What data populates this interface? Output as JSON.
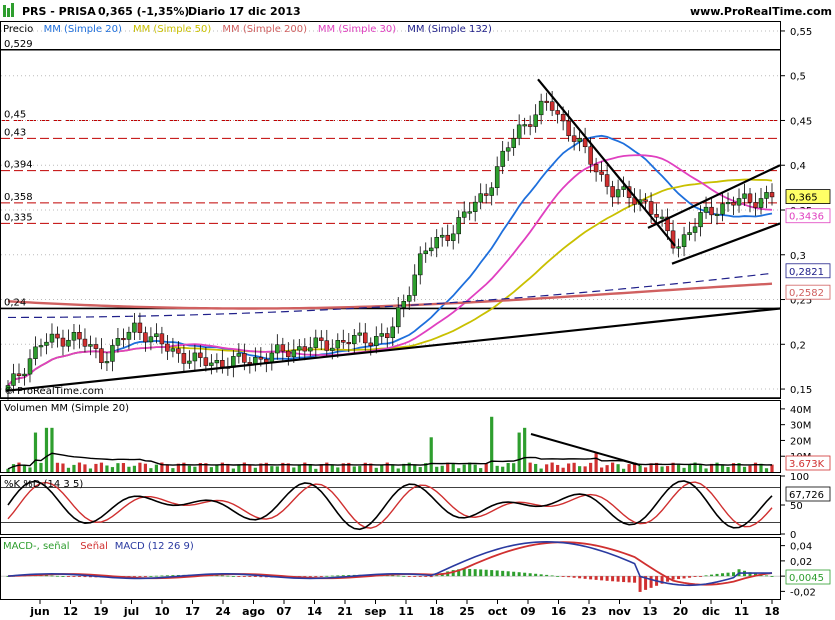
{
  "header": {
    "ticker": "PRS - PRISA",
    "last_change": "0,365 (-1,35%)",
    "period_date": "Diario  17 dic 2013",
    "site": "www.ProRealTime.com"
  },
  "price_panel": {
    "legend": [
      {
        "text": "Precio",
        "color": "#000000"
      },
      {
        "text": "MM (Simple 20)",
        "color": "#1e6fdc"
      },
      {
        "text": "MM (Simple 50)",
        "color": "#c9c000"
      },
      {
        "text": "MM (Simple 200)",
        "color": "#d06060"
      },
      {
        "text": "MM (Simple 30)",
        "color": "#e040c0"
      },
      {
        "text": "MM (Simple 132)",
        "color": "#20208a"
      }
    ],
    "copyright": "© ProRealTime.com",
    "level_labels": [
      "0,529",
      "0,45",
      "0,43",
      "0,394",
      "0,358",
      "0,335",
      "0,24"
    ],
    "axis_ticks": [
      "0,55",
      "0,5",
      "0,45",
      "0,4",
      "0,35",
      "0,3",
      "0,25",
      "0,2",
      "0,15"
    ],
    "badges": [
      {
        "text": "0,365",
        "color": "#000000",
        "bg": "#ffff66"
      },
      {
        "text": "0,3436",
        "color": "#e040c0",
        "bg": "#ffffff"
      },
      {
        "text": "0,2821",
        "color": "#20208a",
        "bg": "#ffffff"
      },
      {
        "text": "0,2582",
        "color": "#d06060",
        "bg": "#ffffff"
      }
    ]
  },
  "volume_panel": {
    "legend": "Volumen MM (Simple 20)",
    "axis_ticks": [
      "40M",
      "30M",
      "20M",
      "10M"
    ],
    "badge": "3.673K"
  },
  "stoch_panel": {
    "legend": "%K %D (14 3 5)",
    "axis_ticks": [
      "100",
      "50",
      "0"
    ],
    "badge": "67,726"
  },
  "macd_panel": {
    "legend_parts": [
      {
        "text": "MACD-, señal",
        "color": "#2e9e2e"
      },
      {
        "text": "Señal",
        "color": "#d03030"
      },
      {
        "text": "MACD (12 26 9)",
        "color": "#2a3aa0"
      }
    ],
    "axis_ticks": [
      "0,04",
      "0,02",
      "0",
      "-0,02"
    ],
    "badge": "0,0045"
  },
  "x_axis": {
    "labels": [
      "jun",
      "12",
      "19",
      "jul",
      "10",
      "17",
      "24",
      "ago",
      "07",
      "14",
      "21",
      "sep",
      "11",
      "18",
      "25",
      "oct",
      "09",
      "16",
      "23",
      "nov",
      "13",
      "20",
      "dic",
      "11",
      "18"
    ]
  },
  "chart_data": {
    "type": "candlestick",
    "title": "PRS - PRISA",
    "period": "Diario",
    "date": "17 dic 2013",
    "last": 0.365,
    "change_pct": -1.35,
    "y_axis": {
      "range": [
        0.14,
        0.56
      ],
      "ticks": [
        0.55,
        0.5,
        0.45,
        0.4,
        0.35,
        0.3,
        0.25,
        0.2,
        0.15
      ]
    },
    "horizontal_levels": [
      0.529,
      0.45,
      0.43,
      0.394,
      0.358,
      0.335,
      0.24,
      0.14
    ],
    "close_estimates": [
      {
        "date": "jun",
        "close": 0.15
      },
      {
        "date": "12",
        "close": 0.2
      },
      {
        "date": "19",
        "close": 0.21
      },
      {
        "date": "jul",
        "close": 0.185
      },
      {
        "date": "10",
        "close": 0.22
      },
      {
        "date": "17",
        "close": 0.195
      },
      {
        "date": "24",
        "close": 0.18
      },
      {
        "date": "ago",
        "close": 0.18
      },
      {
        "date": "07",
        "close": 0.185
      },
      {
        "date": "14",
        "close": 0.195
      },
      {
        "date": "21",
        "close": 0.2
      },
      {
        "date": "sep",
        "close": 0.205
      },
      {
        "date": "11",
        "close": 0.21
      },
      {
        "date": "18",
        "close": 0.3
      },
      {
        "date": "25",
        "close": 0.33
      },
      {
        "date": "oct",
        "close": 0.37
      },
      {
        "date": "09",
        "close": 0.44
      },
      {
        "date": "16",
        "close": 0.47
      },
      {
        "date": "23",
        "close": 0.42
      },
      {
        "date": "nov",
        "close": 0.37
      },
      {
        "date": "13",
        "close": 0.36
      },
      {
        "date": "20",
        "close": 0.31
      },
      {
        "date": "dic",
        "close": 0.35
      },
      {
        "date": "11",
        "close": 0.36
      },
      {
        "date": "18",
        "close": 0.365
      }
    ],
    "indicators": {
      "MM (Simple 30)": 0.3436,
      "MM (Simple 132)": 0.2821,
      "MM (Simple 200)": 0.2582,
      "Volumen MM (Simple 20)": "3.673K",
      "%K %D (14 3 5)": 67.726,
      "MACD (12 26 9)": 0.0045
    }
  }
}
